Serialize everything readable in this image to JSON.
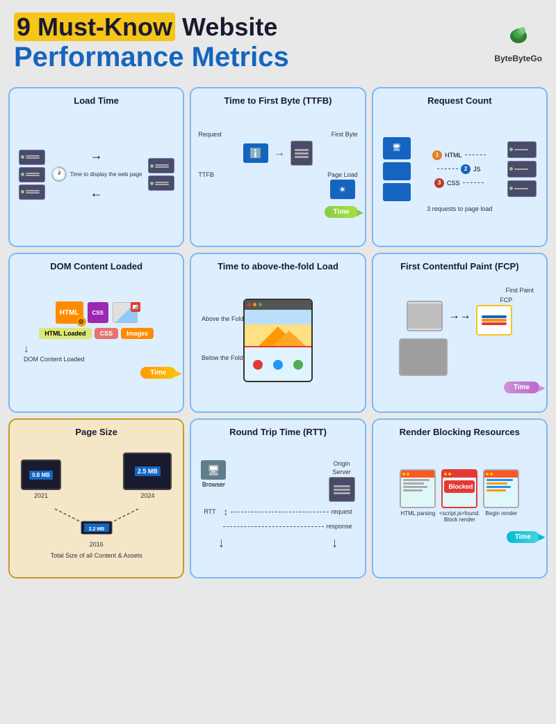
{
  "header": {
    "title_highlight": "9 Must-Know",
    "title_rest": " Website",
    "title_line2": "Performance Metrics",
    "logo_name": "ByteByteGo"
  },
  "cards": {
    "load_time": {
      "title": "Load Time",
      "label": "Time to display the web page"
    },
    "ttfb": {
      "title": "Time to First Byte (TTFB)",
      "label_request": "Request",
      "label_first_byte": "First Byte",
      "label_ttfb": "TTFB",
      "label_page_load": "Page Load",
      "label_time": "Time"
    },
    "request_count": {
      "title": "Request Count",
      "label_html": "HTML",
      "label_js": "JS",
      "label_css": "CSS",
      "label_footer": "3 requests to page load"
    },
    "dom": {
      "title": "DOM Content Loaded",
      "label_html_loaded": "HTML Loaded",
      "label_css": "CSS",
      "label_images": "Images",
      "label_dom": "DOM Content Loaded",
      "label_time": "Time"
    },
    "fold": {
      "title": "Time to above-the-fold Load",
      "label_above": "Above the Fold",
      "label_below": "Below the Fold"
    },
    "fcp": {
      "title": "First Contentful Paint (FCP)",
      "label_first_paint": "First Paint",
      "label_fcp": "FCP",
      "label_time": "Time"
    },
    "page_size": {
      "title": "Page Size",
      "year1": "2021",
      "year2": "2024",
      "year3": "2016",
      "size1": "0.8 MB",
      "size2": "2.5 MB",
      "size3": "2.2 MB",
      "label_total": "Total Size of all Content & Assets"
    },
    "rtt": {
      "title": "Round Trip Time (RTT)",
      "label_browser": "Browser",
      "label_origin": "Origin",
      "label_server": "Server",
      "label_rtt": "RTT",
      "label_request": "request",
      "label_response": "response"
    },
    "render": {
      "title": "Render Blocking Resources",
      "label_blocked": "Blocked",
      "label_html": "HTML parsing",
      "label_script": "<script.js>found. Block render",
      "label_begin": "Begin render",
      "label_time": "Time"
    }
  }
}
